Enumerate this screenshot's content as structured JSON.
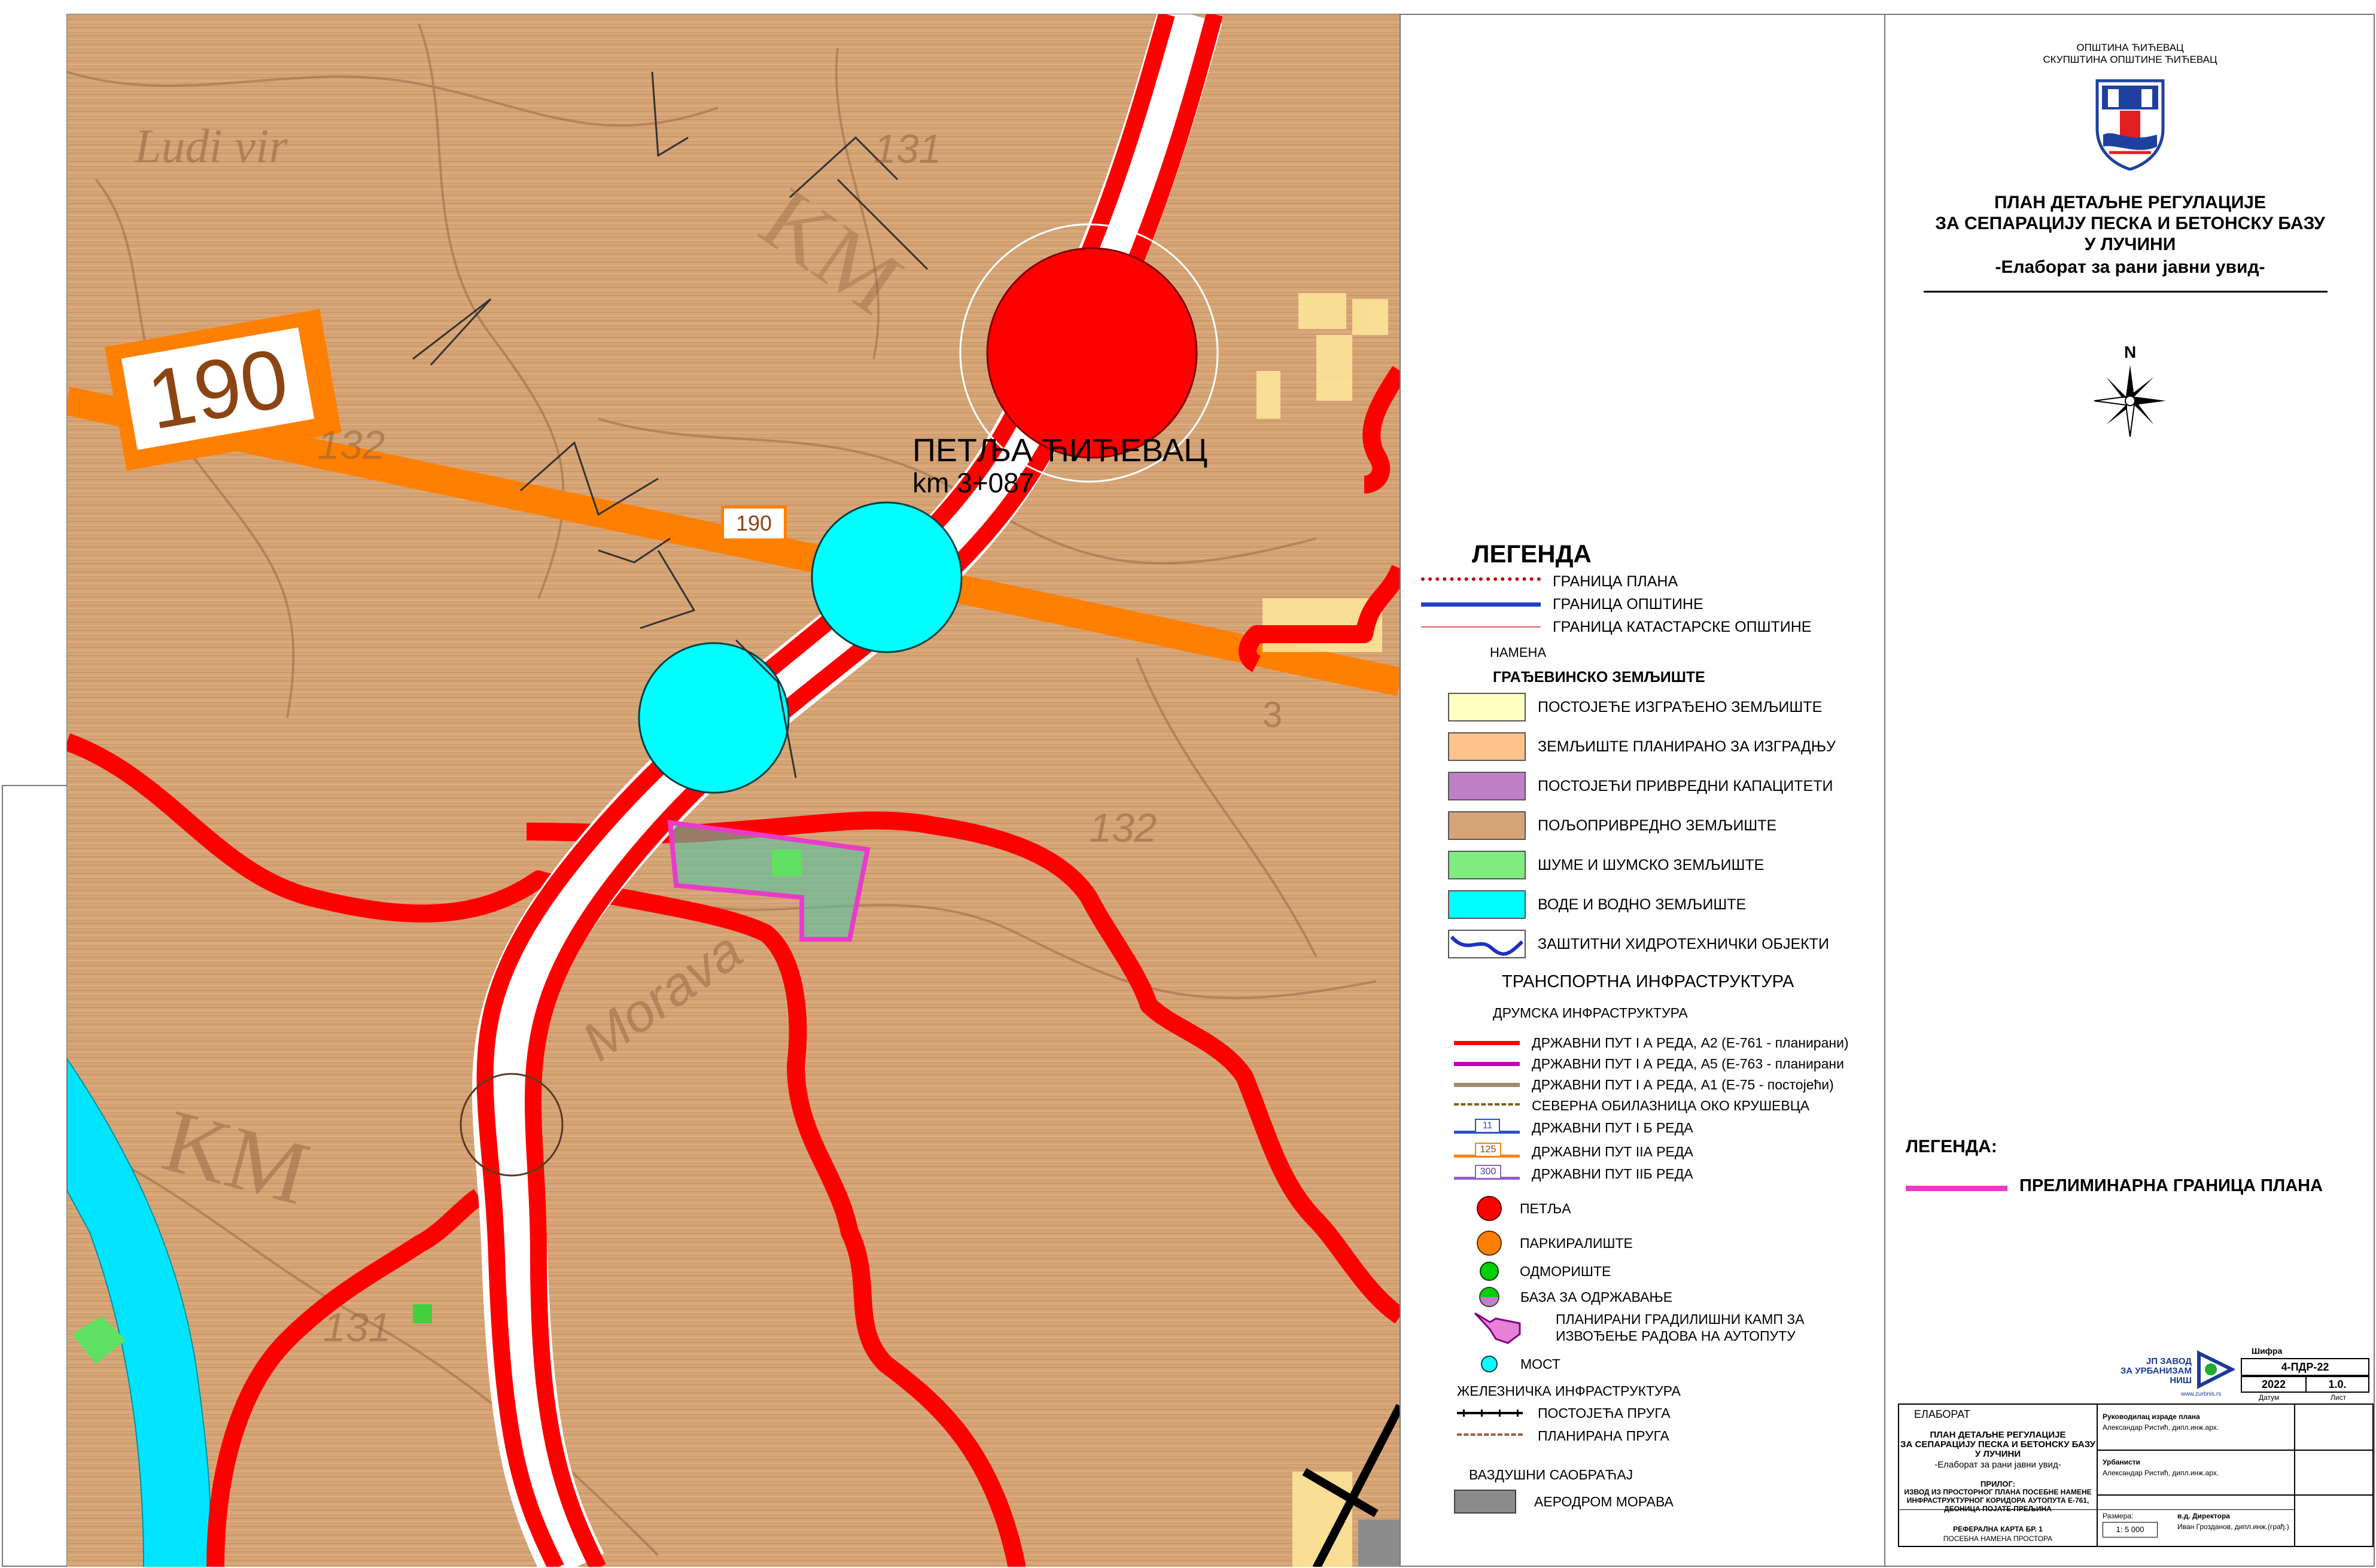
{
  "colors": {
    "map_background": "#d6a577",
    "wood_stripe": "#c28c5c",
    "road_red": "#ff0000",
    "road_orange": "#ff8000",
    "water_cyan": "#00e5ff",
    "plan_boundary_magenta": "#e83cc8",
    "built_land_yellow": "#ffffc0",
    "planned_land_orange": "#ffc28a",
    "industrial_purple": "#c080c8",
    "agri_brown": "#d6a577",
    "forest_green": "#80ec80",
    "airport_gray": "#8c8c8c",
    "rest_green": "#00d000"
  },
  "map": {
    "road_badge_big": "190",
    "road_badge_small": "190",
    "junction_name": "ПЕТЉА ЋИЋЕВАЦ",
    "junction_km": "km 3+087",
    "topo_labels": [
      "Ludi vir",
      "131",
      "132",
      "132",
      "3",
      "131",
      "Morava",
      "KM",
      "KM"
    ]
  },
  "legend": {
    "title": "ЛЕГЕНДА",
    "boundaries": [
      {
        "label": "ГРАНИЦА ПЛАНА",
        "style": "dotted-red"
      },
      {
        "label": "ГРАНИЦА ОПШТИНЕ",
        "style": "blue"
      },
      {
        "label": "ГРАНИЦА КАТАСТАРСКЕ ОПШТИНЕ",
        "style": "thin-red"
      }
    ],
    "purpose_header": "НАМЕНА",
    "building_land_header": "ГРАЂЕВИНСКО ЗЕМЉИШТЕ",
    "land_uses": [
      {
        "label": "ПОСТОЈЕЋЕ ИЗГРАЂЕНО ЗЕМЉИШТЕ",
        "color": "#ffffc0"
      },
      {
        "label": "ЗЕМЉИШТЕ ПЛАНИРАНО ЗА ИЗГРАДЊУ",
        "color": "#ffc28a"
      },
      {
        "label": "ПОСТОЈЕЋИ ПРИВРЕДНИ КАПАЦИТЕТИ",
        "color": "#c080c8"
      },
      {
        "label": "ПОЉОПРИВРЕДНО ЗЕМЉИШТЕ",
        "color": "#d6a577"
      },
      {
        "label": "ШУМЕ И ШУМСКО ЗЕМЉИШТЕ",
        "color": "#80ec80"
      },
      {
        "label": "ВОДЕ И ВОДНО ЗЕМЉИШТЕ",
        "color": "#00ffff"
      },
      {
        "label": "ЗАШТИТНИ ХИДРОТЕХНИЧКИ ОБЈЕКТИ",
        "color": "#ffffff"
      }
    ],
    "transport_header": "ТРАНСПОРТНА ИНФРАСТРУКТУРА",
    "road_header": "ДРУМСКА ИНФРАСТРУКТУРА",
    "roads": [
      {
        "label": "ДРЖАВНИ ПУТ I А РЕДА, А2 (Е-761 - планирани)",
        "color": "#ff0000",
        "badge": ""
      },
      {
        "label": "ДРЖАВНИ ПУТ I А РЕДА, А5 (Е-763 - планирани",
        "color": "#c000c0",
        "badge": ""
      },
      {
        "label": "ДРЖАВНИ ПУТ I А РЕДА, А1 (Е-75 - постојећи)",
        "color": "#a08a70",
        "badge": ""
      },
      {
        "label": "СЕВЕРНА ОБИЛАЗНИЦА ОКО КРУШЕВЦА",
        "color": "#806020",
        "badge": ""
      },
      {
        "label": "ДРЖАВНИ ПУТ I Б РЕДА",
        "color": "#3050c0",
        "badge": "11"
      },
      {
        "label": "ДРЖАВНИ ПУТ IIА РЕДА",
        "color": "#ff8000",
        "badge": "125"
      },
      {
        "label": "ДРЖАВНИ ПУТ IIБ РЕДА",
        "color": "#9060d0",
        "badge": "300"
      }
    ],
    "points": [
      {
        "label": "ПЕТЉА",
        "color": "#ff0000"
      },
      {
        "label": "ПАРКИРАЛИШТЕ",
        "color": "#ff8000"
      },
      {
        "label": "ОДМОРИШТЕ",
        "color": "#00d000"
      },
      {
        "label": "БАЗА ЗА ОДРЖАВАЊЕ",
        "color": "#00d000"
      }
    ],
    "camp_label_line1": "ПЛАНИРАНИ ГРАДИЛИШНИ КАМП ЗА",
    "camp_label_line2": "ИЗВОЂЕЊЕ РАДОВА НА АУТОПУТУ",
    "bridge_label": "МОСТ",
    "rail_header": "ЖЕЛЕЗНИЧКА ИНФРАСТРУКТУРА",
    "rail": [
      {
        "label": "ПОСТОЈЕЋА ПРУГА"
      },
      {
        "label": "ПЛАНИРАНА ПРУГА"
      }
    ],
    "air_header": "ВАЗДУШНИ САОБРАЋАЈ",
    "airport_label": "АЕРОДРОМ МОРАВА"
  },
  "legend2": {
    "title": "ЛЕГЕНДА:",
    "item_label": "ПРЕЛИМИНАРНА ГРАНИЦА ПЛАНА",
    "item_color": "#e83cc8"
  },
  "titleblock": {
    "municipality": "ОПШТИНА ЋИЋЕВАЦ",
    "assembly": "СКУПШТИНА ОПШТИНЕ ЋИЋЕВАЦ",
    "plan_title_1": "ПЛАН ДЕТАЉНЕ РЕГУЛАЦИЈЕ",
    "plan_title_2": "ЗА СЕПАРАЦИЈУ ПЕСКА И БЕТОНСКУ БАЗУ",
    "plan_title_3": "У ЛУЧИНИ",
    "plan_subtitle": "-Елаборат за рани јавни увид-",
    "north": "N"
  },
  "stamp": {
    "institute_1": "ЈП ЗАВОД",
    "institute_2": "ЗА УРБАНИЗАМ",
    "institute_3": "НИШ",
    "website": "www.zurbnis.rs",
    "code_label": "Шифра",
    "code": "4-ПДР-22",
    "year": "2022",
    "version": "1.0.",
    "date_label": "Датум",
    "sheet_label": "Лист",
    "elaborat": "ЕЛАБОРАТ",
    "small_title_1": "ПЛАН ДЕТАЉНЕ РЕГУЛАЦИЈЕ",
    "small_title_2": "ЗА СЕПАРАЦИЈУ ПЕСКА И БЕТОНСКУ БАЗУ",
    "small_title_3": "У ЛУЧИНИ",
    "small_subtitle": "-Елаборат за рани јавни увид-",
    "attachment_1": "ПРИЛОГ:",
    "attachment_2": "ИЗВОД ИЗ ПРОСТОРНОГ ПЛАНА ПОСЕБНЕ НАМЕНЕ",
    "attachment_3": "ИНФРАСТРУКТУРНОГ КОРИДОРА АУТОПУТА Е-761,",
    "attachment_4": "ДЕОНИЦА ПОЈАТЕ-ПРЕЉИНА",
    "map_ref_1": "РЕФЕРАЛНА КАРТА БР. 1",
    "map_ref_2": "ПОСЕБНА НАМЕНА ПРОСТОРА",
    "lead_label": "Руководилац израде плана",
    "lead_name": "Александар Ристић, дипл.инж.арх.",
    "urban_label": "Урбанисти",
    "urban_name": "Александар Ристић, дипл.инж.арх.",
    "scale_label": "Размера:",
    "scale": "1: 5 000",
    "director_label": "в.д. Директора",
    "director_name": "Иван Грозданов, дипл.инж.(грађ.)"
  }
}
